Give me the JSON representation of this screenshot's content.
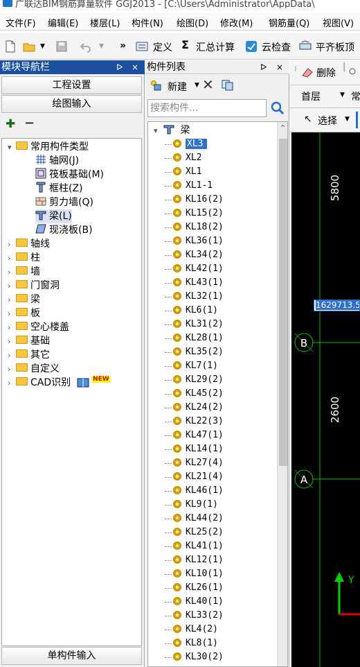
{
  "title_bar": {
    "text": "广联达BIM钢筋算量软件 GGJ2013 - [C:\\Users\\Administrator\\AppData\\"
  },
  "menu": [
    "文件(F)",
    "编辑(E)",
    "楼层(L)",
    "构件(N)",
    "绘图(D)",
    "修改(M)",
    "钢筋量(Q)",
    "视图(V)"
  ],
  "toolbar": {
    "more": "»",
    "define": "定义",
    "sum_calc": "汇总计算",
    "cloud_check": "云检查",
    "flat_board": "平齐板顶"
  },
  "nav": {
    "title": "模块导航栏",
    "pin": "ᐅ",
    "close": "×",
    "btn_project": "工程设置",
    "btn_draw": "绘图输入",
    "btn_single": "单构件输入",
    "tree": [
      {
        "label": "常用构件类型",
        "level": 0,
        "expanded": true
      },
      {
        "label": "轴网(J)",
        "level": 1,
        "icon": "grid-axis-icon"
      },
      {
        "label": "筏板基础(M)",
        "level": 1,
        "icon": "raft-foundation-icon"
      },
      {
        "label": "框柱(Z)",
        "level": 1,
        "icon": "frame-column-icon"
      },
      {
        "label": "剪力墙(Q)",
        "level": 1,
        "icon": "shear-wall-icon"
      },
      {
        "label": "梁(L)",
        "level": 1,
        "icon": "beam-icon",
        "selected": true
      },
      {
        "label": "现浇板(B)",
        "level": 1,
        "icon": "slab-icon"
      },
      {
        "label": "轴线",
        "level": 0
      },
      {
        "label": "柱",
        "level": 0
      },
      {
        "label": "墙",
        "level": 0
      },
      {
        "label": "门窗洞",
        "level": 0
      },
      {
        "label": "梁",
        "level": 0
      },
      {
        "label": "板",
        "level": 0
      },
      {
        "label": "空心楼盖",
        "level": 0
      },
      {
        "label": "基础",
        "level": 0
      },
      {
        "label": "其它",
        "level": 0
      },
      {
        "label": "自定义",
        "level": 0
      },
      {
        "label": "CAD识别",
        "level": 0,
        "badge": "NEW"
      }
    ]
  },
  "list": {
    "title": "构件列表",
    "pin": "ᐅ",
    "close": "×",
    "new_label": "新建",
    "search_placeholder": "搜索构件...",
    "root": "梁",
    "items": [
      "XL3",
      "XL2",
      "XL1",
      "XL1-1",
      "KL16(2)",
      "KL15(2)",
      "KL18(2)",
      "KL36(1)",
      "KL34(2)",
      "KL42(1)",
      "KL43(1)",
      "KL32(1)",
      "KL6(1)",
      "KL31(2)",
      "KL28(1)",
      "KL35(2)",
      "KL7(1)",
      "KL29(2)",
      "KL45(2)",
      "KL24(2)",
      "KL22(3)",
      "KL47(1)",
      "KL14(1)",
      "KL27(4)",
      "KL21(4)",
      "KL46(1)",
      "KL9(1)",
      "KL44(2)",
      "KL25(2)",
      "KL41(1)",
      "KL12(1)",
      "KL10(1)",
      "KL26(1)",
      "KL40(1)",
      "KL33(2)",
      "KL4(2)",
      "KL8(1)",
      "KL30(2)"
    ],
    "selected_index": 0
  },
  "canvas": {
    "delete_label": "删除",
    "floor_label": "首层",
    "select_label": "选择",
    "dim_5800": "5800",
    "dim_2600": "2600",
    "axis_b": "B",
    "axis_a": "A",
    "axis_y": "Y",
    "coord_input": "1629713.5"
  },
  "colors": {
    "title_blue": "#1c4fa0",
    "selection": "#3070c8",
    "axis_green": "#00c000",
    "axis_red": "#e00000",
    "canvas_bg": "#000000"
  }
}
